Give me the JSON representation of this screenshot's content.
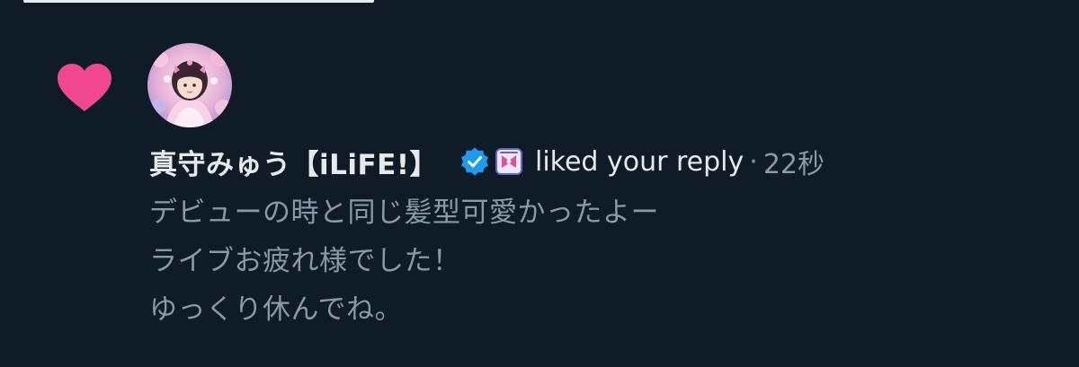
{
  "notification": {
    "type_icon": "heart-icon",
    "accent_color": "#f0478f",
    "avatar": "user-avatar",
    "display_name": "真守みゅう【iLiFE!】",
    "verified_icon": "verified-badge-icon",
    "verified_color": "#1d9bf0",
    "affiliate_badge": "affiliate-badge-icon",
    "action": "liked your reply",
    "separator": "·",
    "timestamp": "22秒",
    "reply_lines": [
      "デビューの時と同じ髪型可愛かったよー",
      "ライブお疲れ様でした！",
      "ゆっくり休んでね。"
    ]
  }
}
